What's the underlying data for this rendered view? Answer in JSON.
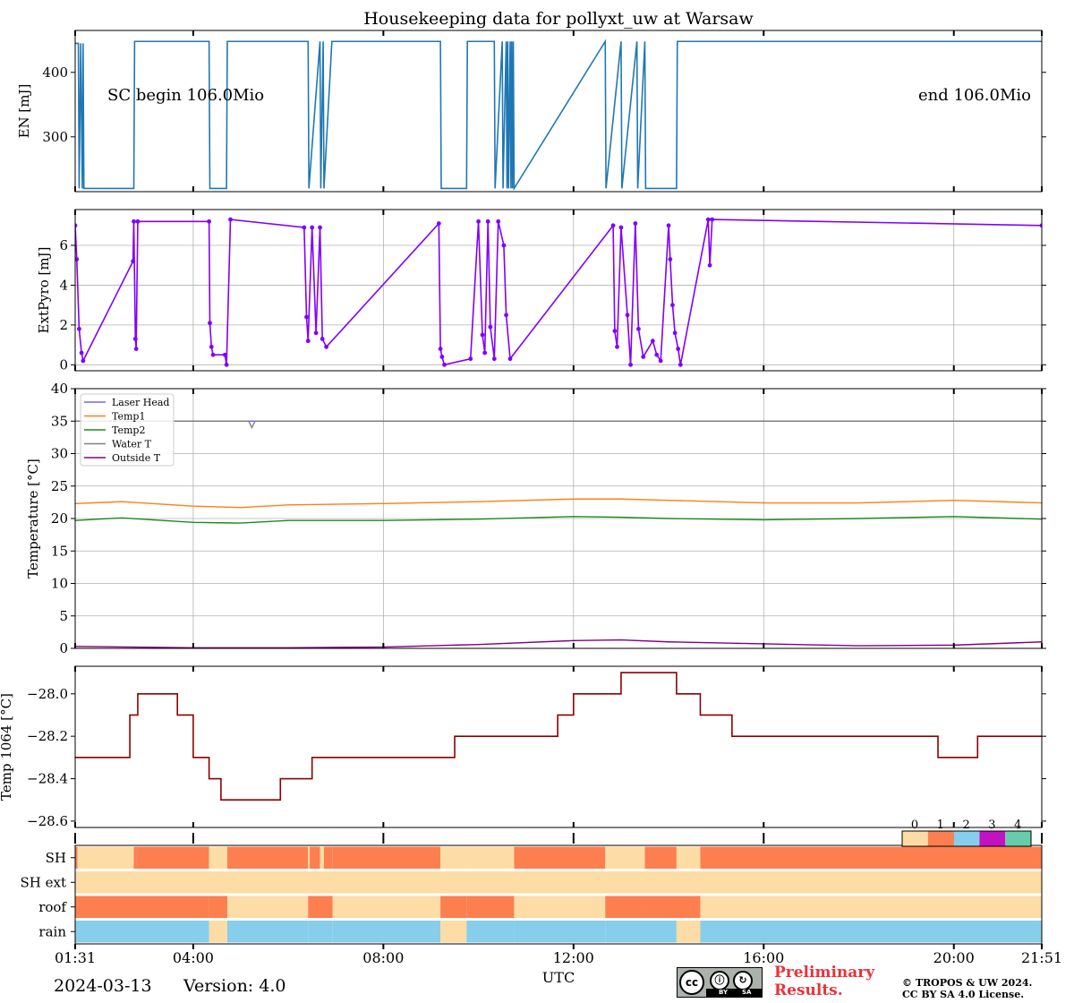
{
  "title": "Housekeeping data for pollyxt_uw at Warsaw",
  "x_axis": {
    "label": "UTC",
    "start": "01:31",
    "end": "21:51",
    "ticks": [
      "01:31",
      "04:00",
      "08:00",
      "12:00",
      "16:00",
      "20:00",
      "21:51"
    ]
  },
  "footer": {
    "date": "2024-03-13",
    "version": "Version: 4.0",
    "preliminary_line1": "Preliminary",
    "preliminary_line2": "Results.",
    "copyright_line1": "© TROPOS & UW 2024.",
    "copyright_line2": "CC BY SA 4.0 License.",
    "license_badge": [
      "cc",
      "BY",
      "SA"
    ]
  },
  "colors": {
    "energy": "#1f77b4",
    "extpyro": "#8000ff",
    "temp1064": "#8b0000",
    "flag0": "#fddca5",
    "flag1": "#fd7f4f",
    "flag2": "#87ceeb",
    "flag3": "#c212c2",
    "flag4": "#66cdaa"
  },
  "chart_data": [
    {
      "type": "line",
      "panel": "EN",
      "ylabel": "EN [mJ]",
      "ylim": [
        215,
        465
      ],
      "yticks": [
        300,
        400
      ],
      "annotations": {
        "left": "SC begin 106.0Mio",
        "right": "end 106.0Mio"
      },
      "series": [
        {
          "x": [
            "01:31",
            "01:35",
            "01:36",
            "01:38",
            "01:40",
            "01:41",
            "01:42",
            "02:45",
            "02:46",
            "02:48",
            "04:20",
            "04:21",
            "04:42",
            "04:43",
            "06:25",
            "06:26",
            "06:40",
            "06:41",
            "06:44",
            "06:45",
            "06:55",
            "06:56",
            "09:12",
            "09:13",
            "09:45",
            "09:46",
            "10:20",
            "10:21",
            "10:30",
            "10:31",
            "10:35",
            "10:36",
            "10:37",
            "10:38",
            "10:40",
            "10:41",
            "10:42",
            "10:43",
            "10:44",
            "10:45",
            "12:40",
            "12:41",
            "13:00",
            "13:01",
            "13:20",
            "13:21",
            "13:30",
            "13:31",
            "14:10",
            "14:11",
            "14:40",
            "14:41",
            "21:51"
          ],
          "y": [
            445,
            445,
            220,
            445,
            220,
            445,
            220,
            220,
            448,
            448,
            448,
            220,
            220,
            448,
            448,
            220,
            448,
            220,
            448,
            220,
            448,
            448,
            448,
            220,
            220,
            448,
            448,
            220,
            448,
            220,
            448,
            220,
            448,
            220,
            448,
            220,
            448,
            220,
            448,
            220,
            448,
            220,
            448,
            220,
            448,
            220,
            448,
            220,
            220,
            448,
            448,
            448,
            448
          ]
        }
      ]
    },
    {
      "type": "line",
      "panel": "ExtPyro",
      "ylabel": "ExtPyro [mJ]",
      "ylim": [
        -0.3,
        7.8
      ],
      "yticks": [
        0,
        2,
        4,
        6
      ],
      "series": [
        {
          "x": [
            "01:31",
            "01:33",
            "01:36",
            "01:39",
            "01:41",
            "02:44",
            "02:45",
            "02:47",
            "02:48",
            "02:50",
            "04:20",
            "04:21",
            "04:23",
            "04:25",
            "04:40",
            "04:42",
            "04:47",
            "06:20",
            "06:23",
            "06:25",
            "06:30",
            "06:35",
            "06:40",
            "06:43",
            "06:48",
            "09:10",
            "09:12",
            "09:14",
            "09:17",
            "09:50",
            "10:00",
            "10:05",
            "10:08",
            "10:12",
            "10:15",
            "10:20",
            "10:25",
            "10:32",
            "10:35",
            "10:40",
            "12:50",
            "12:52",
            "12:55",
            "13:00",
            "13:08",
            "13:12",
            "13:18",
            "13:22",
            "13:28",
            "13:40",
            "13:45",
            "13:50",
            "14:00",
            "14:02",
            "14:05",
            "14:08",
            "14:12",
            "14:15",
            "14:50",
            "14:52",
            "14:55",
            "21:51"
          ],
          "y": [
            7.0,
            5.3,
            1.8,
            0.6,
            0.2,
            5.2,
            7.2,
            1.3,
            0.8,
            7.2,
            7.2,
            2.1,
            0.9,
            0.5,
            0.5,
            0.0,
            7.3,
            6.9,
            2.4,
            1.2,
            6.9,
            1.6,
            6.9,
            1.3,
            0.9,
            7.1,
            0.8,
            0.4,
            0.0,
            0.3,
            7.2,
            1.5,
            0.6,
            7.2,
            1.9,
            0.3,
            7.2,
            6.0,
            2.5,
            0.3,
            7.0,
            1.7,
            0.9,
            6.9,
            2.5,
            0.0,
            7.1,
            1.8,
            0.4,
            1.2,
            0.5,
            0.2,
            7.0,
            5.3,
            3.0,
            1.6,
            0.8,
            0.0,
            7.3,
            5.0,
            7.3,
            7.0
          ]
        }
      ]
    },
    {
      "type": "line",
      "panel": "Temperature",
      "ylabel": "Temperature [$^\\circ C$]",
      "ylim": [
        0,
        40
      ],
      "yticks": [
        0,
        5,
        10,
        15,
        20,
        25,
        30,
        35,
        40
      ],
      "legend": "upper left",
      "series": [
        {
          "name": "Laser Head",
          "x": [
            "01:31",
            "21:51"
          ],
          "y": [
            35,
            35
          ]
        },
        {
          "name": "Temp1",
          "x": [
            "01:31",
            "02:30",
            "04:00",
            "05:00",
            "06:00",
            "08:00",
            "10:00",
            "12:00",
            "13:00",
            "14:00",
            "16:00",
            "18:00",
            "20:00",
            "21:51"
          ],
          "y": [
            22.3,
            22.6,
            21.9,
            21.7,
            22.1,
            22.3,
            22.6,
            23.0,
            23.0,
            22.8,
            22.4,
            22.4,
            22.8,
            22.4
          ]
        },
        {
          "name": "Temp2",
          "x": [
            "01:31",
            "02:30",
            "04:00",
            "05:00",
            "06:00",
            "08:00",
            "10:00",
            "12:00",
            "13:00",
            "14:00",
            "16:00",
            "18:00",
            "20:00",
            "21:51"
          ],
          "y": [
            19.7,
            20.1,
            19.4,
            19.3,
            19.7,
            19.7,
            19.9,
            20.3,
            20.2,
            20.0,
            19.8,
            20.0,
            20.3,
            19.9
          ]
        },
        {
          "name": "Water T",
          "x": [
            "01:31",
            "05:10",
            "05:14",
            "05:18",
            "21:51"
          ],
          "y": [
            35,
            35,
            34.0,
            35,
            35
          ]
        },
        {
          "name": "Outside T",
          "x": [
            "01:31",
            "04:00",
            "06:00",
            "08:00",
            "10:00",
            "12:00",
            "13:00",
            "14:00",
            "16:00",
            "18:00",
            "20:00",
            "21:51"
          ],
          "y": [
            0.3,
            0.1,
            0.1,
            0.2,
            0.6,
            1.2,
            1.3,
            1.0,
            0.7,
            0.4,
            0.5,
            1.0
          ]
        }
      ]
    },
    {
      "type": "line",
      "panel": "Temp 1064",
      "ylabel": "Temp 1064 [$^\\circ C$]",
      "ylim": [
        -28.63,
        -27.87
      ],
      "yticks": [
        -28.6,
        -28.4,
        -28.2,
        -28.0
      ],
      "series": [
        {
          "x": [
            "01:31",
            "02:20",
            "02:40",
            "02:50",
            "03:20",
            "03:40",
            "04:00",
            "04:20",
            "04:35",
            "05:30",
            "05:50",
            "06:10",
            "06:30",
            "07:00",
            "08:00",
            "09:00",
            "09:30",
            "10:10",
            "11:00",
            "11:40",
            "12:00",
            "12:30",
            "13:00",
            "14:10",
            "14:40",
            "15:00",
            "15:20",
            "16:00",
            "17:00",
            "18:00",
            "19:00",
            "19:40",
            "20:00",
            "20:30",
            "21:00",
            "21:51"
          ],
          "y": [
            -28.3,
            -28.3,
            -28.1,
            -28.0,
            -28.0,
            -28.1,
            -28.3,
            -28.4,
            -28.5,
            -28.5,
            -28.4,
            -28.4,
            -28.3,
            -28.3,
            -28.3,
            -28.3,
            -28.2,
            -28.2,
            -28.2,
            -28.1,
            -28.0,
            -28.0,
            -27.9,
            -28.0,
            -28.1,
            -28.1,
            -28.2,
            -28.2,
            -28.2,
            -28.2,
            -28.2,
            -28.3,
            -28.3,
            -28.2,
            -28.2,
            -28.2
          ]
        }
      ]
    },
    {
      "type": "heatmap",
      "panel": "flags",
      "rows": [
        "SH",
        "SH ext",
        "roof",
        "rain"
      ],
      "colorbar_ticks": [
        "0",
        "1",
        "2",
        "3",
        "4"
      ],
      "segments": {
        "SH": [
          [
            "01:31",
            "01:34",
            1
          ],
          [
            "01:34",
            "01:40",
            0
          ],
          [
            "01:40",
            "02:45",
            0
          ],
          [
            "02:45",
            "02:50",
            1
          ],
          [
            "02:50",
            "04:20",
            1
          ],
          [
            "04:20",
            "04:43",
            0
          ],
          [
            "04:43",
            "06:25",
            1
          ],
          [
            "06:25",
            "06:27",
            0
          ],
          [
            "06:27",
            "06:40",
            1
          ],
          [
            "06:40",
            "06:45",
            0
          ],
          [
            "06:45",
            "06:56",
            1
          ],
          [
            "06:56",
            "09:12",
            1
          ],
          [
            "09:12",
            "09:45",
            0
          ],
          [
            "09:45",
            "10:45",
            0
          ],
          [
            "10:45",
            "12:40",
            1
          ],
          [
            "12:40",
            "13:30",
            0
          ],
          [
            "13:30",
            "14:10",
            1
          ],
          [
            "14:10",
            "14:40",
            0
          ],
          [
            "14:40",
            "21:51",
            1
          ]
        ],
        "SH ext": [
          [
            "01:31",
            "21:51",
            0
          ]
        ],
        "roof": [
          [
            "01:31",
            "04:20",
            1
          ],
          [
            "04:20",
            "04:43",
            1
          ],
          [
            "04:43",
            "06:25",
            0
          ],
          [
            "06:25",
            "06:56",
            1
          ],
          [
            "06:56",
            "09:12",
            0
          ],
          [
            "09:12",
            "09:45",
            1
          ],
          [
            "09:45",
            "10:45",
            1
          ],
          [
            "10:45",
            "12:40",
            0
          ],
          [
            "12:40",
            "13:30",
            1
          ],
          [
            "13:30",
            "14:40",
            1
          ],
          [
            "14:40",
            "21:51",
            0
          ]
        ],
        "rain": [
          [
            "01:31",
            "02:45",
            2
          ],
          [
            "02:45",
            "04:20",
            2
          ],
          [
            "04:20",
            "04:43",
            0
          ],
          [
            "04:43",
            "06:25",
            2
          ],
          [
            "06:25",
            "06:56",
            2
          ],
          [
            "06:56",
            "09:12",
            2
          ],
          [
            "09:12",
            "09:45",
            0
          ],
          [
            "09:45",
            "10:45",
            2
          ],
          [
            "10:45",
            "12:40",
            2
          ],
          [
            "12:40",
            "13:30",
            2
          ],
          [
            "13:30",
            "14:10",
            2
          ],
          [
            "14:10",
            "14:40",
            0
          ],
          [
            "14:40",
            "21:51",
            2
          ]
        ]
      }
    }
  ]
}
